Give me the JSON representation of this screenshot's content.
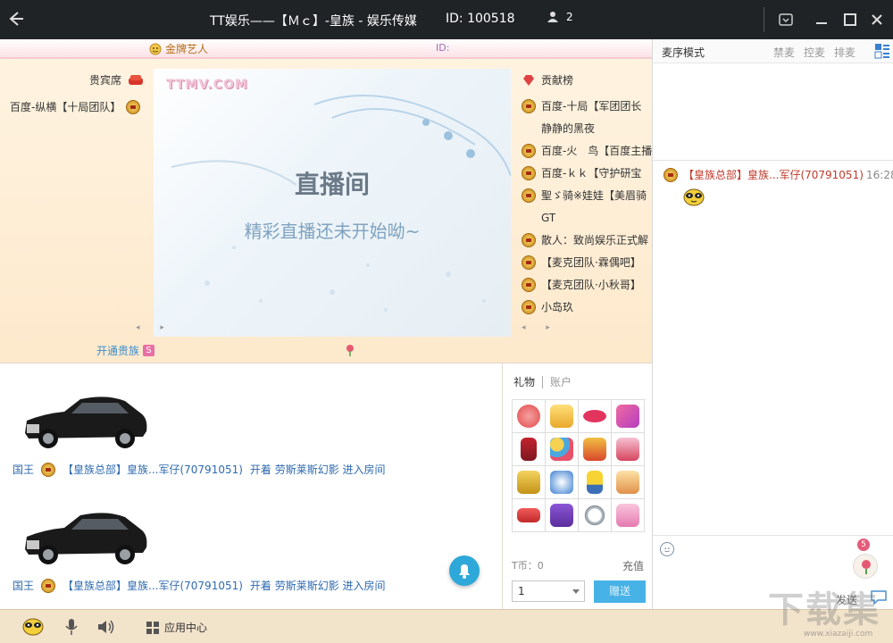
{
  "titlebar": {
    "main_title": "TT娱乐——【Ｍｃ】-皇族 - 娱乐传媒",
    "room_id": "ID: 100518",
    "user_count": "2"
  },
  "stage": {
    "gold_artist": "金牌艺人",
    "id_label": "ID:",
    "vip_title": "贵宾席",
    "vip_items": [
      "百度-纵横【十局团队】"
    ],
    "video_logo": "TTMV.COM",
    "live_title": "直播间",
    "live_sub": "精彩直播还未开始呦~",
    "contrib_title": "贡献榜",
    "contributors": [
      {
        "name": "百度-十局【军团团长",
        "medal": true
      },
      {
        "name": "静静的黑夜",
        "medal": false
      },
      {
        "name": "百度-火　鸟【百度主播",
        "medal": true
      },
      {
        "name": "百度-ｋｋ【守护研宝",
        "medal": true
      },
      {
        "name": "聖ゞ骑※娃娃【美眉骑",
        "medal": true
      },
      {
        "name": "GT",
        "medal": false
      },
      {
        "name": "散人：致尚娱乐正式解",
        "medal": true
      },
      {
        "name": "【麦克团队·霖偶吧】",
        "medal": true
      },
      {
        "name": "【麦克团队·小秋哥】",
        "medal": true
      },
      {
        "name": "小岛玖",
        "medal": true
      }
    ],
    "pager": "◂ ▸",
    "open_vip": "开通贵族",
    "open_vip_badge": "S"
  },
  "feed": {
    "entries": [
      {
        "title": "国王",
        "who": "【皇族总部】皇族...军仔",
        "uid": "(70791051)",
        "action": "开着 劳斯莱斯幻影 进入房间"
      },
      {
        "title": "国王",
        "who": "【皇族总部】皇族...军仔",
        "uid": "(70791051)",
        "action": "开着 劳斯莱斯幻影 进入房间"
      }
    ]
  },
  "gifts": {
    "tab_gift": "礼物",
    "tab_account": "账户",
    "items": [
      "lollipop-icon",
      "clap-icon",
      "lips-icon",
      "magic-wand-icon",
      "wine-icon",
      "balloons-icon",
      "heart-box-icon",
      "cake-icon",
      "microphone-icon",
      "bouquet-icon",
      "minion-icon",
      "love-note-icon",
      "car-icon",
      "purple-bag-icon",
      "ring-icon",
      "dress-icon"
    ],
    "t_coin": "T币：0",
    "recharge": "充值",
    "quantity": "1",
    "give": "赠送"
  },
  "chat": {
    "mic_mode": "麦序模式",
    "mic_options": [
      "禁麦",
      "控麦",
      "排麦"
    ],
    "message_name": "【皇族总部】皇族...军仔(70791051)",
    "message_time": "16:28",
    "flower_count": "5",
    "send": "发送"
  },
  "bottombar": {
    "app_center": "应用中心"
  },
  "watermark": {
    "main": "下载集",
    "sub": "www.xiazaiji.com"
  }
}
